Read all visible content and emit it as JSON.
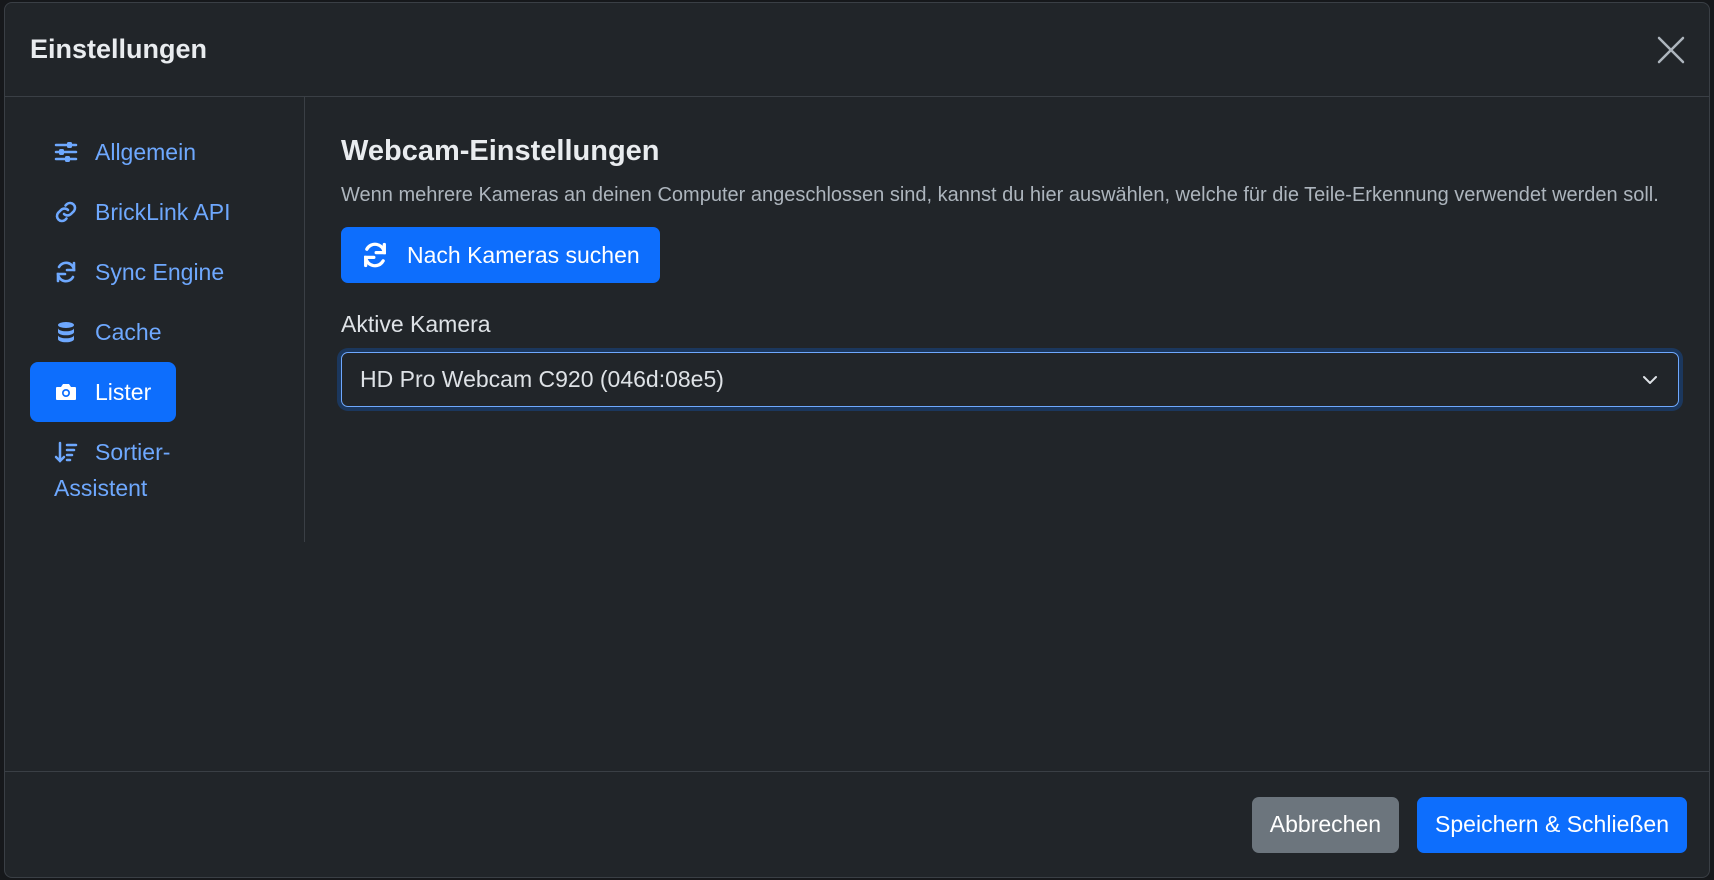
{
  "modal": {
    "title": "Einstellungen"
  },
  "sidebar": {
    "items": [
      {
        "label": "Allgemein",
        "icon": "sliders-icon"
      },
      {
        "label": "BrickLink API",
        "icon": "link-icon"
      },
      {
        "label": "Sync Engine",
        "icon": "sync-icon"
      },
      {
        "label": "Cache",
        "icon": "database-icon"
      },
      {
        "label": "Lister",
        "icon": "camera-icon",
        "active": true
      },
      {
        "label": "Sortier-Assistent",
        "label_line1": "Sortier-",
        "label_line2": "Assistent",
        "icon": "sort-icon"
      }
    ]
  },
  "main": {
    "section_title": "Webcam-Einstellungen",
    "description": "Wenn mehrere Kameras an deinen Computer angeschlossen sind, kannst du hier auswählen, welche für die Teile-Erkennung verwendet werden soll.",
    "scan_button_label": "Nach Kameras suchen",
    "camera_label": "Aktive Kamera",
    "camera_selected": "HD Pro Webcam C920 (046d:08e5)"
  },
  "footer": {
    "cancel_label": "Abbrechen",
    "save_label": "Speichern & Schließen"
  },
  "colors": {
    "accent": "#0d6efd",
    "link": "#6ea8fe",
    "background": "#212529"
  }
}
